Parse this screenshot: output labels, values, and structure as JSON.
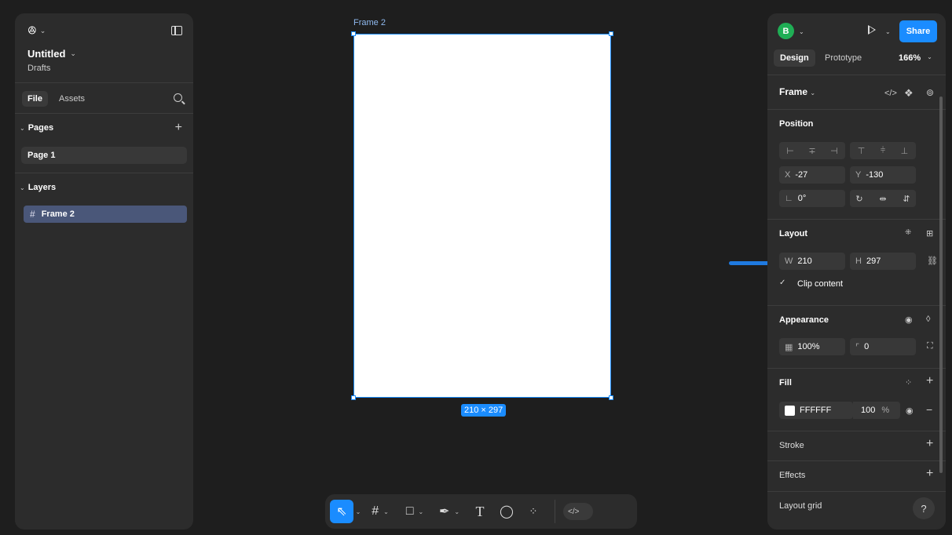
{
  "left_panel": {
    "file_title": "Untitled",
    "file_location": "Drafts",
    "tabs": {
      "file": "File",
      "assets": "Assets"
    },
    "pages_label": "Pages",
    "pages": [
      "Page 1"
    ],
    "layers_label": "Layers",
    "layers": [
      "Frame 2"
    ]
  },
  "canvas": {
    "frame_label": "Frame 2",
    "dimensions_badge": "210 × 297"
  },
  "right_panel": {
    "avatar_initial": "B",
    "share_label": "Share",
    "tabs": {
      "design": "Design",
      "prototype": "Prototype"
    },
    "zoom": "166%",
    "selection_type": "Frame",
    "position": {
      "label": "Position",
      "x_label": "X",
      "x": "-27",
      "y_label": "Y",
      "y": "-130",
      "rotation": "0°"
    },
    "layout": {
      "label": "Layout",
      "w_label": "W",
      "w": "210",
      "h_label": "H",
      "h": "297",
      "clip_content": "Clip content"
    },
    "appearance": {
      "label": "Appearance",
      "opacity": "100%",
      "radius": "0"
    },
    "fill": {
      "label": "Fill",
      "hex": "FFFFFF",
      "opacity": "100",
      "unit": "%"
    },
    "stroke_label": "Stroke",
    "effects_label": "Effects",
    "layout_grid_label": "Layout grid",
    "help": "?"
  },
  "colors": {
    "accent": "#1a8cff",
    "panel": "#2c2c2c",
    "canvas": "#1e1e1e",
    "selected_layer": "#4a5779",
    "avatar": "#1fae55",
    "annotation_arrow": "#1f7ae0"
  }
}
